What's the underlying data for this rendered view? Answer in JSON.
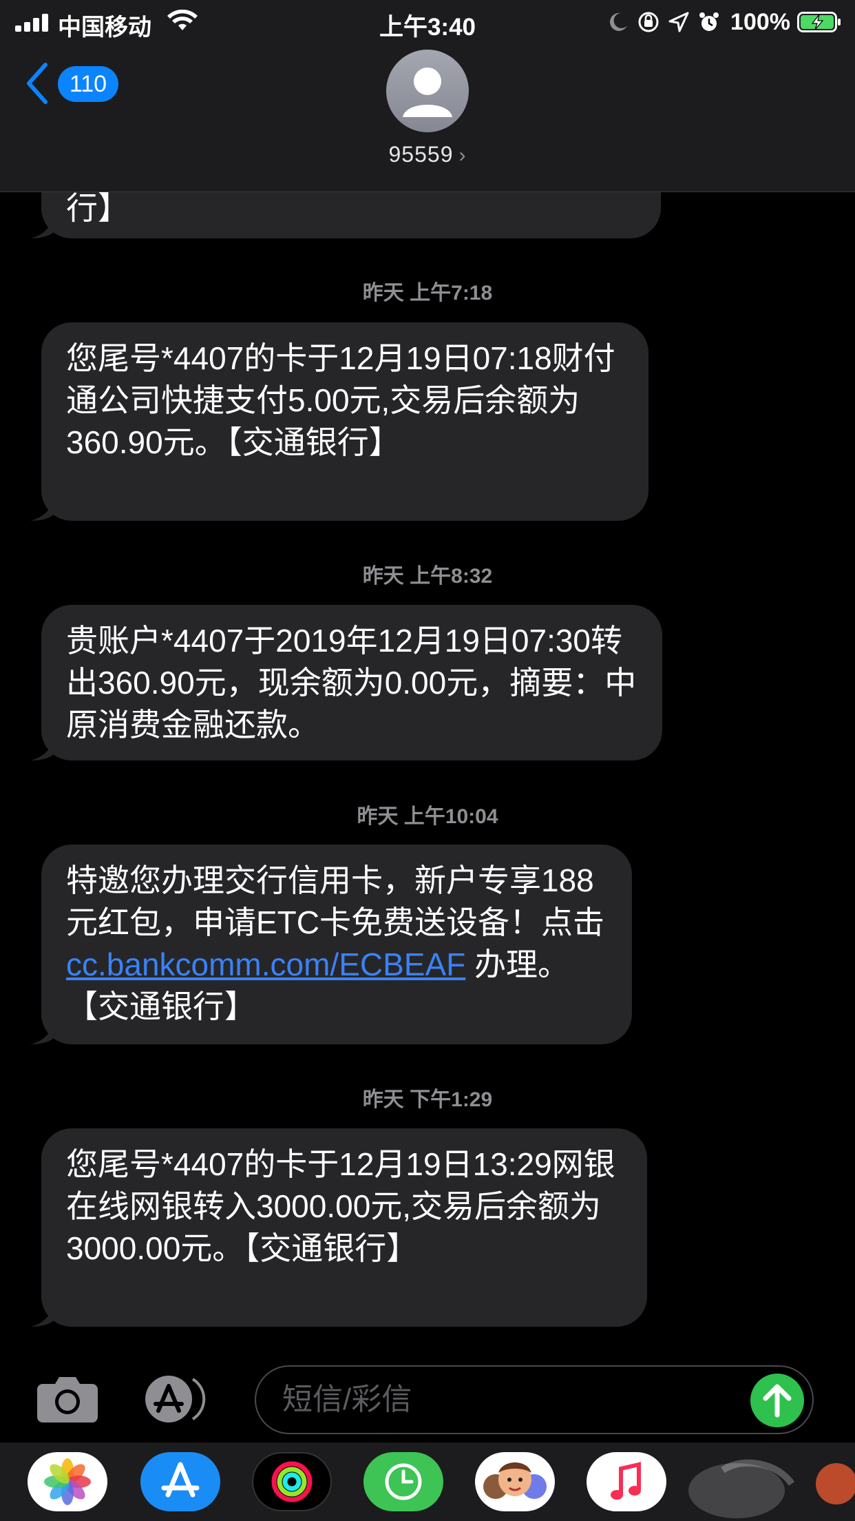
{
  "status": {
    "carrier": "中国移动",
    "time": "上午3:40",
    "battery": "100%"
  },
  "header": {
    "back_count": "110",
    "contact": "95559",
    "chevron": "›"
  },
  "partial_bubble": {
    "text": "行】"
  },
  "messages": [
    {
      "timestamp": "昨天 上午7:18",
      "text": "您尾号*4407的卡于12月19日07:18财付通公司快捷支付5.00元,交易后余额为360.90元。【交通银行】"
    },
    {
      "timestamp": "昨天 上午8:32",
      "text": "贵账户*4407于2019年12月19日07:30转出360.90元，现余额为0.00元，摘要：中原消费金融还款。"
    },
    {
      "timestamp": "昨天 上午10:04",
      "text_before": "特邀您办理交行信用卡，新户专享188元红包，申请ETC卡免费送设备！点击 ",
      "link": "cc.bankcomm.com/ECBEAF",
      "text_after": " 办理。【交通银行】"
    },
    {
      "timestamp": "昨天 下午1:29",
      "text": "您尾号*4407的卡于12月19日13:29网银在线网银转入3000.00元,交易后余额为3000.00元。【交通银行】"
    }
  ],
  "input": {
    "placeholder": "短信/彩信"
  },
  "icons": {
    "back": "chevron-left-icon",
    "avatar": "person-icon",
    "camera": "camera-icon",
    "apps": "app-store-icon",
    "send": "arrow-up-icon"
  },
  "drawer_apps": [
    "photos",
    "app-store",
    "activity",
    "clock",
    "memoji",
    "music"
  ],
  "colors": {
    "accent_blue": "#0a84ff",
    "bubble": "#262629",
    "send_green": "#2ec14d",
    "link": "#3a82f7"
  }
}
